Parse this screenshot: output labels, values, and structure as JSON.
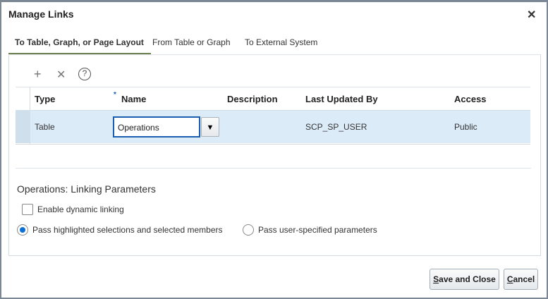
{
  "dialog": {
    "title": "Manage Links",
    "close_icon": "close-icon"
  },
  "tabs": [
    {
      "label": "To Table, Graph, or Page Layout",
      "active": true
    },
    {
      "label": "From Table or Graph",
      "active": false
    },
    {
      "label": "To External System",
      "active": false
    }
  ],
  "toolbar": {
    "add": "+",
    "delete": "✕",
    "help": "?"
  },
  "table": {
    "required_marker": "*",
    "columns": [
      "Type",
      "Name",
      "Description",
      "Last Updated By",
      "Access"
    ],
    "rows": [
      {
        "type": "Table",
        "name": "Operations",
        "description": "",
        "last_updated_by": "SCP_SP_USER",
        "access": "Public"
      }
    ]
  },
  "params": {
    "title": "Operations: Linking Parameters",
    "enable_dynamic_linking": {
      "label": "Enable dynamic linking",
      "checked": false
    },
    "radio_options": [
      {
        "label": "Pass highlighted selections and selected members",
        "selected": true
      },
      {
        "label": "Pass user-specified parameters",
        "selected": false
      }
    ]
  },
  "buttons": {
    "save_first": "S",
    "save_rest": "ave and Close",
    "cancel_first": "C",
    "cancel_rest": "ancel"
  }
}
